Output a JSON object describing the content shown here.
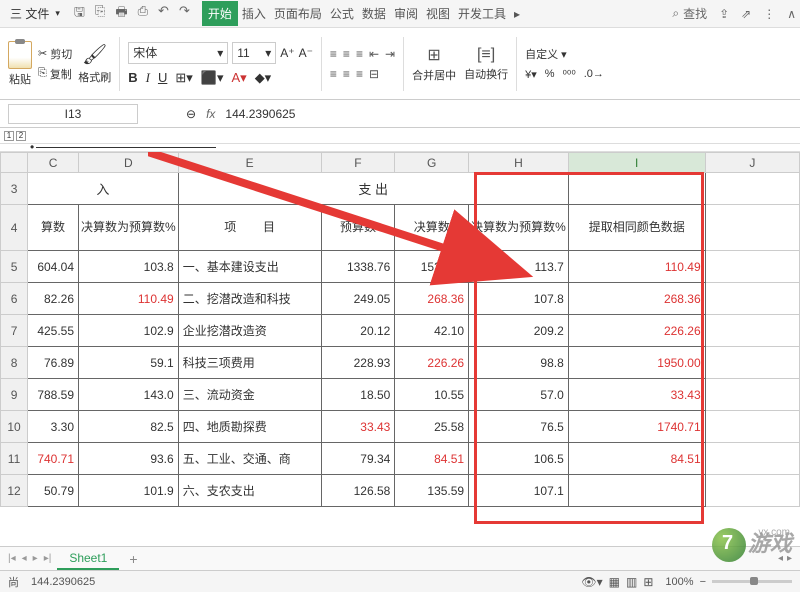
{
  "menu": {
    "file": "三 文件"
  },
  "tabs": [
    "开始",
    "插入",
    "页面布局",
    "公式",
    "数据",
    "审阅",
    "视图",
    "开发工具"
  ],
  "search": "查找",
  "ribbon": {
    "paste": "粘贴",
    "cut": "剪切",
    "copy": "复制",
    "painter": "格式刷",
    "font": "宋体",
    "size": "11",
    "merge": "合并居中",
    "wrap": "自动换行",
    "custom": "自定义"
  },
  "namebox": "I13",
  "fx": "fx",
  "formula": "144.2390625",
  "cols": [
    "C",
    "D",
    "E",
    "F",
    "G",
    "H",
    "I",
    "J"
  ],
  "hdr": {
    "in": "入",
    "out": "支                                    出",
    "extract": "提取相同颜色数据",
    "suanshu": "算数",
    "juesuan_pct": "决算数为预算数%",
    "xiang": "项",
    "mu": "目",
    "yusuan": "预算数",
    "juesuan": "决算数"
  },
  "rows": [
    {
      "r": "5",
      "c": "604.04",
      "d": "103.8",
      "e": "一、基本建设支出",
      "f": "1338.76",
      "g": "1522.77",
      "h": "113.7",
      "i": "110.49",
      "dred": false,
      "gred": false,
      "hred": false
    },
    {
      "r": "6",
      "c": "82.26",
      "d": "110.49",
      "e": "二、挖潜改造和科技",
      "f": "249.05",
      "g": "268.36",
      "h": "107.8",
      "i": "268.36",
      "dred": true,
      "gred": true,
      "hred": false
    },
    {
      "r": "7",
      "c": "425.55",
      "d": "102.9",
      "e": "企业挖潜改造资",
      "f": "20.12",
      "g": "42.10",
      "h": "209.2",
      "i": "226.26",
      "dred": false,
      "gred": false,
      "hred": false
    },
    {
      "r": "8",
      "c": "76.89",
      "d": "59.1",
      "e": "科技三项费用",
      "f": "228.93",
      "g": "226.26",
      "h": "98.8",
      "i": "1950.00",
      "dred": false,
      "gred": true,
      "hred": false
    },
    {
      "r": "9",
      "c": "788.59",
      "d": "143.0",
      "e": "三、流动资金",
      "f": "18.50",
      "g": "10.55",
      "h": "57.0",
      "i": "33.43",
      "dred": false,
      "gred": false,
      "hred": false
    },
    {
      "r": "10",
      "c": "3.30",
      "d": "82.5",
      "e": "四、地质勘探费",
      "f": "33.43",
      "g": "25.58",
      "h": "76.5",
      "i": "1740.71",
      "dred": false,
      "fred": true,
      "gred": false,
      "hred": false
    },
    {
      "r": "11",
      "c": "740.71",
      "d": "93.6",
      "e": "五、工业、交通、商",
      "f": "79.34",
      "g": "84.51",
      "h": "106.5",
      "i": "84.51",
      "cred": true,
      "gred": true,
      "hred": false
    },
    {
      "r": "12",
      "c": "50.79",
      "d": "101.9",
      "e": "六、支农支出",
      "f": "126.58",
      "g": "135.59",
      "h": "107.1",
      "i": "",
      "dred": false,
      "gred": false,
      "hred": false
    }
  ],
  "sheet_tab": "Sheet1",
  "status": {
    "mode": "尚",
    "value": "144.2390625",
    "zoom": "100%"
  },
  "watermark": "游戏",
  "wm_small": "yx.com"
}
